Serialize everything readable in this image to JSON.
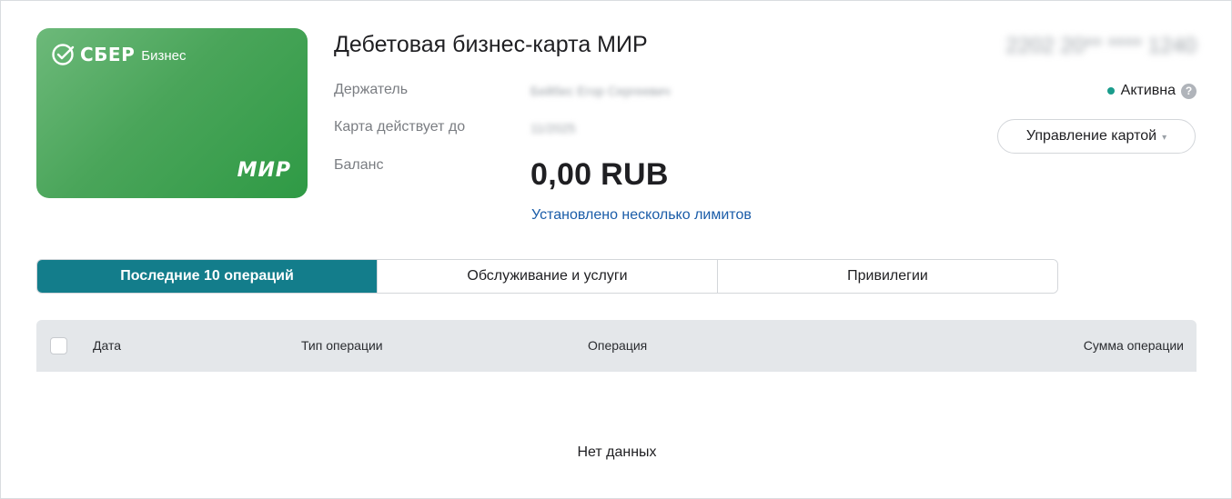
{
  "card": {
    "brand": "СБЕР",
    "brand_sub": "Бизнес",
    "payment_system": "МИР"
  },
  "info": {
    "title": "Дебетовая бизнес-карта МИР",
    "holder_label": "Держатель",
    "holder_value": "Бейбес Егор Сергеевич",
    "expiry_label": "Карта действует до",
    "expiry_value": "11/2025",
    "balance_label": "Баланс",
    "balance_value": "0,00 RUB",
    "limits_link": "Установлено несколько лимитов"
  },
  "right": {
    "card_number": "2202 20** **** 1240",
    "status": "Активна",
    "status_color": "#1a9c8c",
    "help_icon": "?",
    "manage_button": "Управление картой",
    "caret_icon": "▾"
  },
  "tabs": [
    {
      "label": "Последние 10 операций",
      "active": true
    },
    {
      "label": "Обслуживание и услуги",
      "active": false
    },
    {
      "label": "Привилегии",
      "active": false
    }
  ],
  "table": {
    "columns": [
      "Дата",
      "Тип операции",
      "Операция",
      "Сумма операции"
    ],
    "empty_text": "Нет данных"
  },
  "colors": {
    "accent": "#137d8b",
    "link": "#1a5ca8",
    "card_green": "#3a9f4d"
  }
}
